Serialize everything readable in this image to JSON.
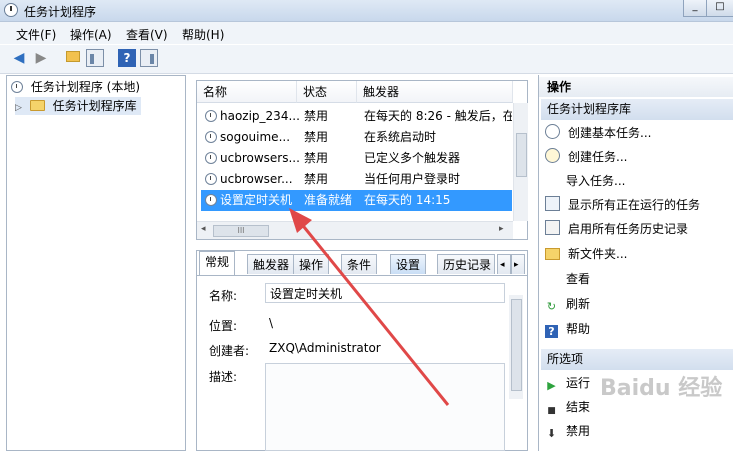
{
  "window": {
    "title": "任务计划程序",
    "controls": [
      "_",
      "□"
    ]
  },
  "menu": [
    "文件(F)",
    "操作(A)",
    "查看(V)",
    "帮助(H)"
  ],
  "toolbar": {
    "back": "◀",
    "forward": "▶",
    "help": "?"
  },
  "tree": {
    "root": "任务计划程序 (本地)",
    "child": "任务计划程序库",
    "expander": "▷"
  },
  "tasklist": {
    "columns": [
      "名称",
      "状态",
      "触发器"
    ],
    "rows": [
      {
        "name": "haozip_234...",
        "status": "禁用",
        "trigger": "在每天的 8:26 - 触发后，在"
      },
      {
        "name": "sogouime...",
        "status": "禁用",
        "trigger": "在系统启动时"
      },
      {
        "name": "ucbrowsers...",
        "status": "禁用",
        "trigger": "已定义多个触发器"
      },
      {
        "name": "ucbrowser...",
        "status": "禁用",
        "trigger": "当任何用户登录时"
      },
      {
        "name": "设置定时关机",
        "status": "准备就绪",
        "trigger": "在每天的 14:15"
      }
    ],
    "hscroll_thumb": "III"
  },
  "detail": {
    "tabs": [
      "常规",
      "触发器",
      "操作",
      "条件",
      "设置",
      "历史记录"
    ],
    "tab_scroll": [
      "◂",
      "▸"
    ],
    "name_label": "名称:",
    "name_value": "设置定时关机",
    "location_label": "位置:",
    "location_value": "\\",
    "author_label": "创建者:",
    "author_value": "ZXQ\\Administrator",
    "desc_label": "描述:"
  },
  "actions": {
    "header": "操作",
    "section1": "任务计划程序库",
    "items1": [
      "创建基本任务...",
      "创建任务...",
      "导入任务...",
      "显示所有正在运行的任务",
      "启用所有任务历史记录",
      "新文件夹...",
      "查看",
      "刷新",
      "帮助"
    ],
    "section2": "所选项",
    "items2": [
      "运行",
      "结束",
      "禁用"
    ]
  },
  "watermark": "Baidu 经验",
  "colors": {
    "selection": "#3399ff",
    "arrow": "#e04848"
  }
}
